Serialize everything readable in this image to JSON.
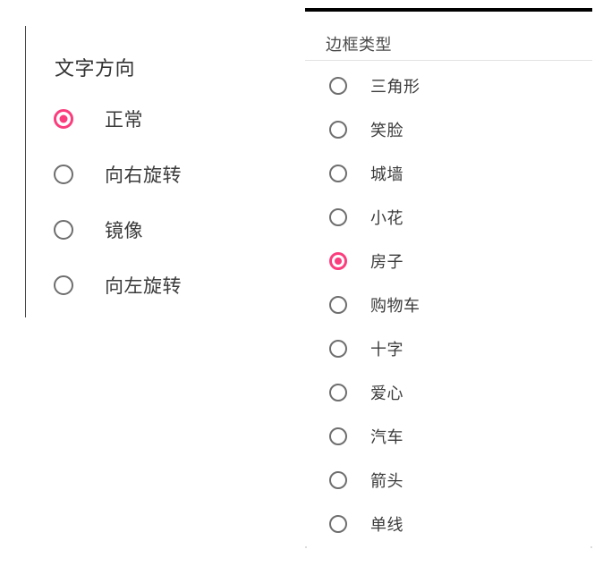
{
  "left_panel": {
    "title": "文字方向",
    "selected_index": 0,
    "options": [
      {
        "label": "正常",
        "checked": true
      },
      {
        "label": "向右旋转",
        "checked": false
      },
      {
        "label": "镜像",
        "checked": false
      },
      {
        "label": "向左旋转",
        "checked": false
      }
    ]
  },
  "right_panel": {
    "title": "边框类型",
    "selected_index": 4,
    "options": [
      {
        "label": "三角形",
        "checked": false
      },
      {
        "label": "笑脸",
        "checked": false
      },
      {
        "label": "城墙",
        "checked": false
      },
      {
        "label": "小花",
        "checked": false
      },
      {
        "label": "房子",
        "checked": true
      },
      {
        "label": "购物车",
        "checked": false
      },
      {
        "label": "十字",
        "checked": false
      },
      {
        "label": "爱心",
        "checked": false
      },
      {
        "label": "汽车",
        "checked": false
      },
      {
        "label": "箭头",
        "checked": false
      },
      {
        "label": "单线",
        "checked": false
      }
    ]
  },
  "theme": {
    "accent": "#fb3d7e",
    "radio_unselected": "#6e6e6e",
    "text": "#3b3b3b",
    "heading": "#333333",
    "heading_right": "#4a4a4a",
    "divider": "#e2e2e2",
    "rule": "#000000",
    "panel_border": "#4a4a4a",
    "background": "#ffffff"
  }
}
